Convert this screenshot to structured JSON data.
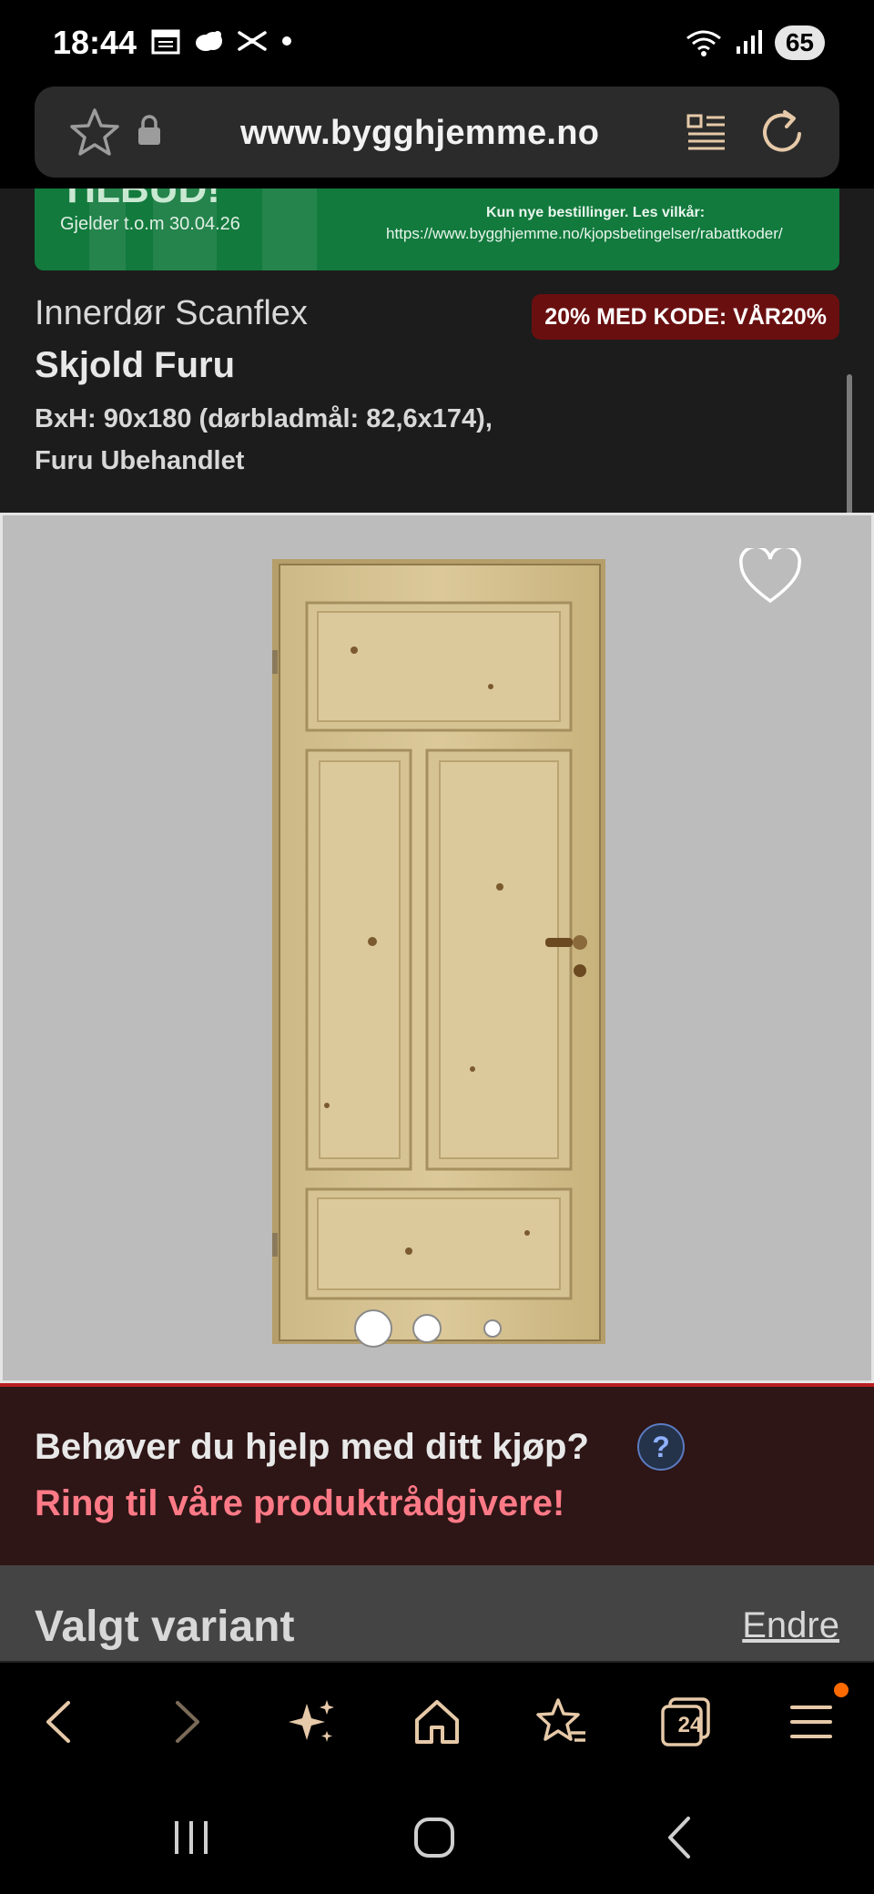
{
  "status_bar": {
    "time": "18:44",
    "battery": "65"
  },
  "browser": {
    "url": "www.bygghjemme.no"
  },
  "promo": {
    "title": "TILBUD!",
    "valid_until": "Gjelder t.o.m 30.04.26",
    "terms_heading": "Kun nye bestillinger. Les vilkår:",
    "terms_url": "https://www.bygghjemme.no/kjopsbetingelser/rabattkoder/"
  },
  "product": {
    "brand_line": "Innerdør Scanflex",
    "name": "Skjold Furu",
    "description": "BxH: 90x180 (dørbladmål: 82,6x174), Furu Ubehandlet",
    "discount_badge": "20% MED KODE: VÅR20%",
    "gallery": {
      "image_count": 3,
      "active_index": 0
    }
  },
  "help": {
    "title": "Behøver du hjelp med ditt kjøp?",
    "link": "Ring til våre produktrådgivere!",
    "icon": "?"
  },
  "variant": {
    "title": "Valgt variant",
    "edit_label": "Endre"
  },
  "toolbar": {
    "tabs_count": "24"
  },
  "colors": {
    "accent_red": "#b81d22",
    "badge_bg": "#6a0f10",
    "help_link": "#ff7a86",
    "promo_green": "#127a3d"
  }
}
